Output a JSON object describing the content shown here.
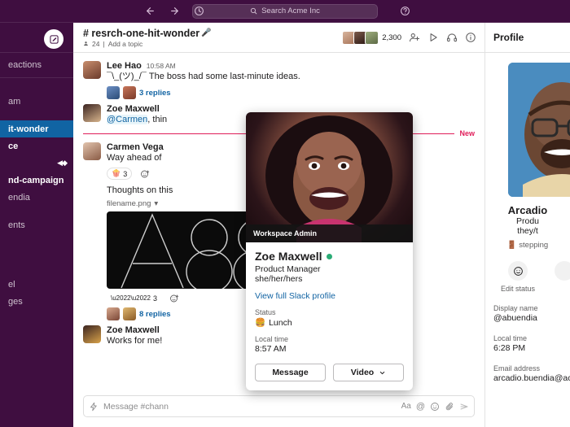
{
  "topbar": {
    "back_icon": "arrow-left-icon",
    "forward_icon": "arrow-right-icon",
    "history_icon": "clock-icon",
    "search_placeholder": "Search Acme Inc",
    "search_icon": "search-icon",
    "help_icon": "question-circle-icon"
  },
  "sidebar": {
    "compose_icon": "compose-icon",
    "items": [
      {
        "label": "eactions",
        "state": "normal"
      },
      {
        "label": "",
        "state": "divider"
      },
      {
        "label": "am",
        "state": "normal"
      },
      {
        "label": "it-wonder",
        "state": "active"
      },
      {
        "label": "ce",
        "state": "unread"
      },
      {
        "label": "",
        "state": "dim",
        "badge": "◀◆"
      },
      {
        "label": "nd-campaign",
        "state": "unread"
      },
      {
        "label": "endia",
        "state": "normal"
      },
      {
        "label": "",
        "state": "gap"
      },
      {
        "label": "ents",
        "state": "normal"
      },
      {
        "label": "",
        "state": "gap"
      },
      {
        "label": "el",
        "state": "normal"
      },
      {
        "label": "ges",
        "state": "normal"
      }
    ]
  },
  "channel": {
    "name": "# resrch-one-hit-wonder",
    "name_emoji": "🎤",
    "member_icon": "person-icon",
    "member_count_small": "24",
    "topic_sep": "|",
    "topic": "Add a topic",
    "total_members": "2,300",
    "add_person_icon": "add-person-icon",
    "huddle_play_icon": "play-icon",
    "headphones_icon": "headphones-icon",
    "info_icon": "info-icon"
  },
  "messages": [
    {
      "name": "Lee Hao",
      "time": "10:58 AM",
      "text": "¯\\_(ツ)_/¯ The boss had some last-minute ideas.",
      "thread_replies": "3 replies",
      "highlight": false
    },
    {
      "name": "Zoe Maxwell",
      "time": "",
      "text_mention": "@Carmen",
      "text": ", thin",
      "highlight": false
    },
    {
      "name": "Carmen Vega",
      "time": "",
      "text": "Way ahead of",
      "reaction_emoji": "🍿",
      "reaction_count": "3",
      "add_reaction_icon": "add-reaction-icon",
      "highlight": false
    },
    {
      "name": "",
      "time": "",
      "text": "Thoughts on this",
      "filename": "filename.png",
      "filename_caret": "▾",
      "reaction_count": "3",
      "thread_replies": "8 replies",
      "highlight": false
    },
    {
      "name": "Zoe Maxwell",
      "time": "",
      "text": "Works for me!",
      "highlight": false
    }
  ],
  "new_divider": {
    "label": "New"
  },
  "composer": {
    "lightning_icon": "lightning-icon",
    "placeholder": "Message #chann",
    "format_icon": "Aa",
    "mention_icon": "@",
    "emoji_icon": "emoji-icon",
    "attach_icon": "paperclip-icon",
    "send_icon": "send-icon"
  },
  "profile_panel": {
    "title": "Profile",
    "name": "Arcadio",
    "role": "Produ",
    "pronouns": "they/t",
    "status_emoji": "🚪",
    "status_text": "stepping",
    "actions": [
      {
        "icon": "emoji-face-icon",
        "label": "Edit status"
      },
      {
        "icon": "more-icon",
        "label": ""
      }
    ],
    "fields": [
      {
        "label": "Display name",
        "value": "@abuendia"
      },
      {
        "label": "Local time",
        "value": "6:28 PM"
      },
      {
        "label": "Email address",
        "value": "arcadio.buendia@acm"
      }
    ]
  },
  "hovercard": {
    "admin_badge": "Workspace Admin",
    "name": "Zoe Maxwell",
    "presence": "active",
    "role": "Product Manager",
    "pronouns": "she/her/hers",
    "profile_link": "View full Slack profile",
    "status_label": "Status",
    "status_emoji": "🍔",
    "status_value": "Lunch",
    "localtime_label": "Local time",
    "localtime_value": "8:57 AM",
    "message_button": "Message",
    "video_button": "Video",
    "video_caret_icon": "chevron-down-icon"
  },
  "colors": {
    "sidebar_bg": "#3F0E40",
    "active_channel": "#1164A3",
    "link": "#1264A3",
    "new_marker": "#E01E5A",
    "presence_green": "#2BAC76"
  }
}
